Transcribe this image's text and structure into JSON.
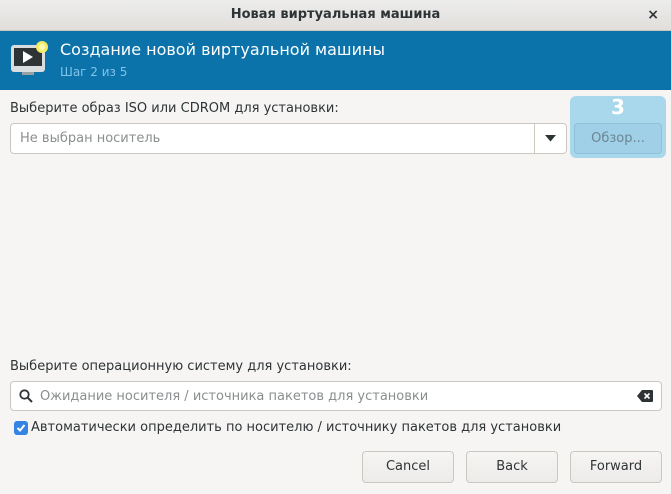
{
  "window": {
    "title": "Новая виртуальная машина",
    "close_glyph": "×"
  },
  "header": {
    "title": "Создание новой виртуальной машины",
    "step": "Шаг 2 из 5",
    "icon": "virtual-machine-new-icon"
  },
  "install_media": {
    "label": "Выберите образ ISO или CDROM для установки:",
    "combo_placeholder": "Не выбран носитель",
    "browse_label": "Обзор...",
    "highlight_number": "3"
  },
  "os": {
    "label": "Выберите операционную систему для установки:",
    "search_placeholder": "Ожидание носителя / источника пакетов для установки",
    "auto_detect_label": "Автоматически определить по носителю / источнику пакетов для установки",
    "auto_detect_checked": true
  },
  "buttons": {
    "cancel": "Cancel",
    "back": "Back",
    "forward": "Forward"
  },
  "colors": {
    "header_bg": "#0b73aa",
    "highlight": "#a9d7ec",
    "checkbox": "#3584e4"
  }
}
